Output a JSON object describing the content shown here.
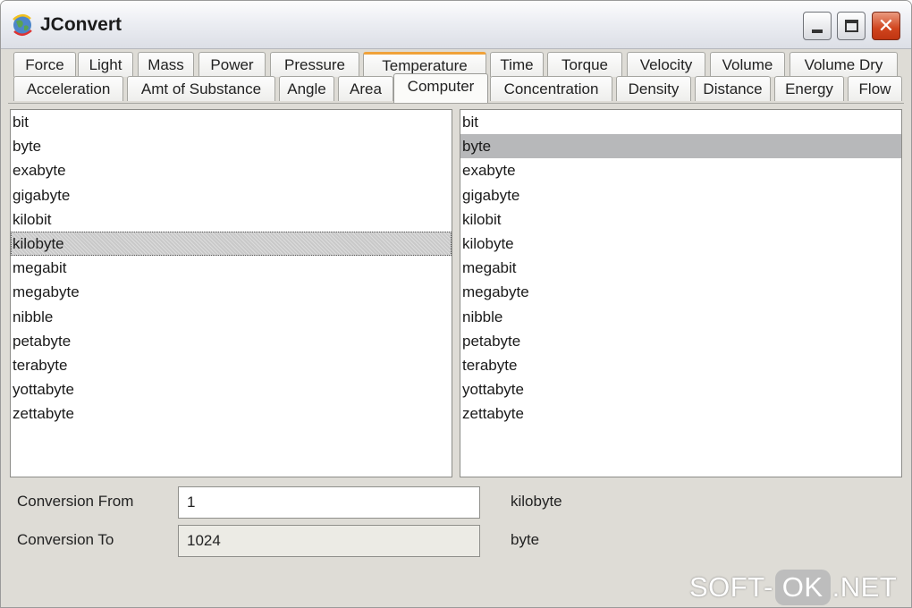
{
  "window": {
    "title": "JConvert",
    "close_glyph": "✕"
  },
  "tabs_top": [
    "Force",
    "Light",
    "Mass",
    "Power",
    "Pressure",
    "Temperature",
    "Time",
    "Torque",
    "Velocity",
    "Volume",
    "Volume Dry"
  ],
  "tabs_bottom": [
    "Acceleration",
    "Amt of Substance",
    "Angle",
    "Area",
    "Computer",
    "Concentration",
    "Density",
    "Distance",
    "Energy",
    "Flow"
  ],
  "active_tab": "Computer",
  "from_units": [
    "bit",
    "byte",
    "exabyte",
    "gigabyte",
    "kilobit",
    "kilobyte",
    "megabit",
    "megabyte",
    "nibble",
    "petabyte",
    "terabyte",
    "yottabyte",
    "zettabyte"
  ],
  "to_units": [
    "bit",
    "byte",
    "exabyte",
    "gigabyte",
    "kilobit",
    "kilobyte",
    "megabit",
    "megabyte",
    "nibble",
    "petabyte",
    "terabyte",
    "yottabyte",
    "zettabyte"
  ],
  "selected_from": "kilobyte",
  "selected_to": "byte",
  "conversion": {
    "from_label": "Conversion From",
    "from_value": "1",
    "from_unit": "kilobyte",
    "to_label": "Conversion To",
    "to_value": "1024",
    "to_unit": "byte"
  },
  "watermark": {
    "left": "SOFT-",
    "mid": "OK",
    "right": ".NET"
  },
  "colors": {
    "tab_highlight": "#f0a23a",
    "selection": "#b7b8ba",
    "close_button": "#d0441d"
  }
}
